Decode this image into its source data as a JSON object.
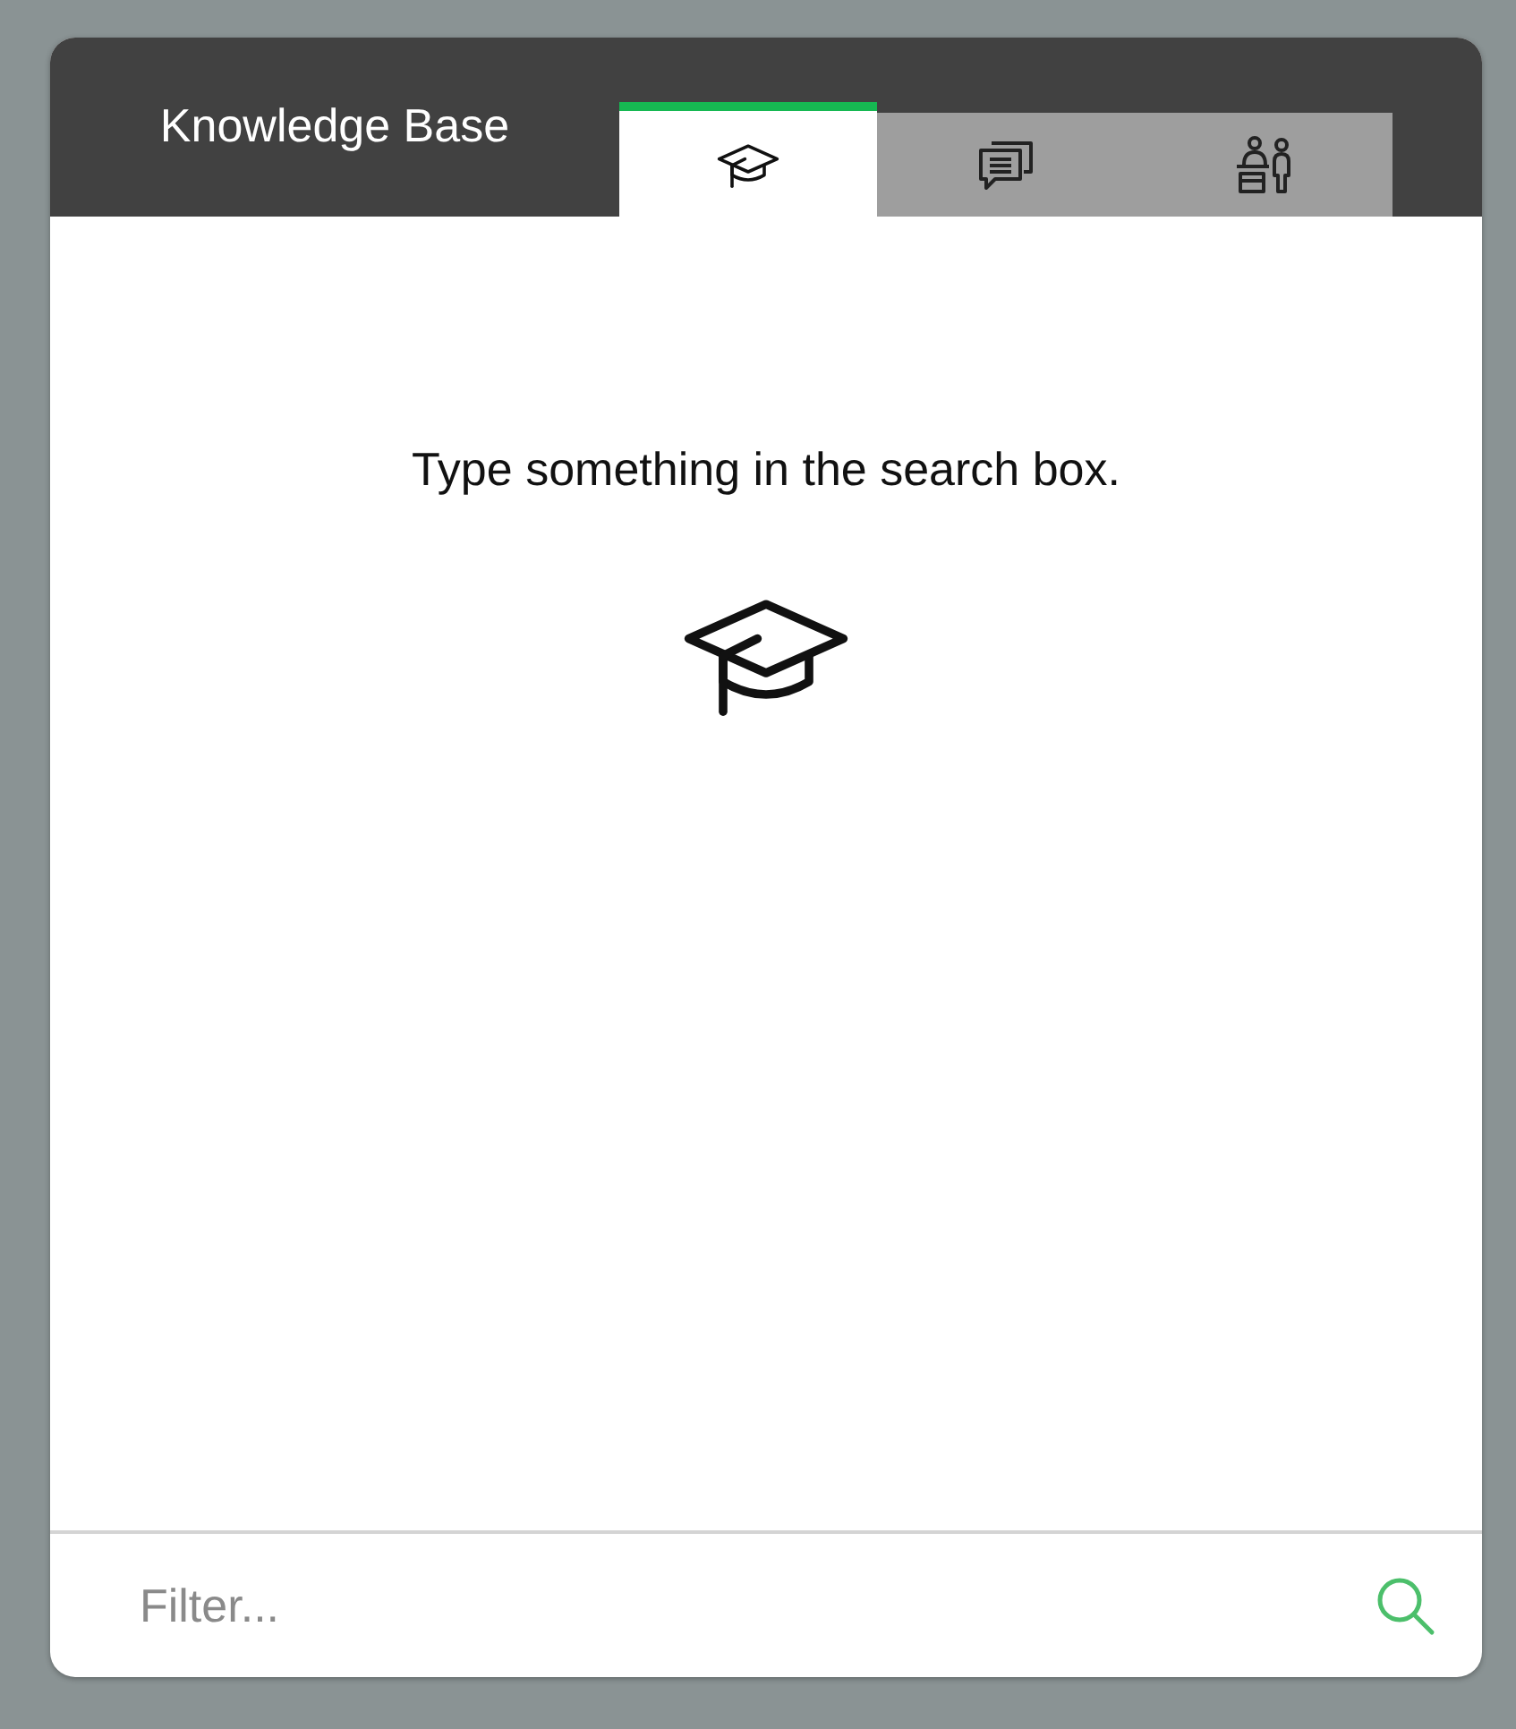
{
  "header": {
    "title": "Knowledge Base"
  },
  "tabs": [
    {
      "kind": "knowledge",
      "selected": true
    },
    {
      "kind": "chat",
      "selected": false
    },
    {
      "kind": "agent",
      "selected": false
    }
  ],
  "empty_state": {
    "message": "Type something in the search box.",
    "kind": "knowledge"
  },
  "filter": {
    "placeholder": "Filter..."
  }
}
